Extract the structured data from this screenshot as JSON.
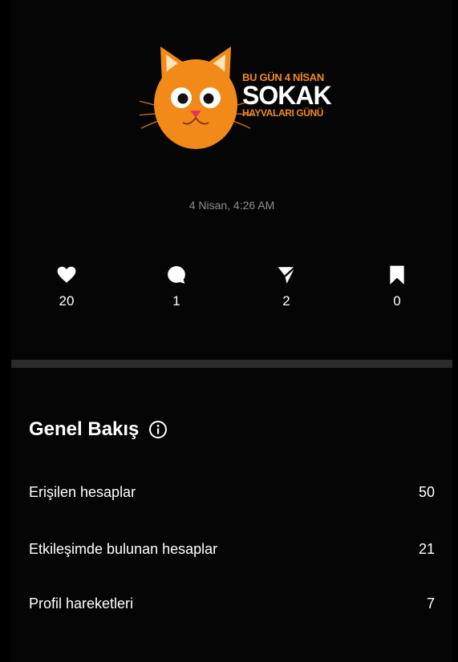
{
  "post": {
    "line1": "BU GÜN 4 NİSAN",
    "line2": "SOKAK",
    "line3": "HAYVALARI GÜNÜ",
    "image_icon": "orange-cat-face",
    "accent_color": "#f28a1a"
  },
  "timestamp": "4 Nisan, 4:26 AM",
  "stats": [
    {
      "icon": "heart-icon",
      "count": "20"
    },
    {
      "icon": "comment-icon",
      "count": "1"
    },
    {
      "icon": "share-icon",
      "count": "2"
    },
    {
      "icon": "bookmark-icon",
      "count": "0"
    }
  ],
  "overview": {
    "title": "Genel Bakış",
    "info_icon": "info-icon",
    "rows": [
      {
        "label": "Erişilen hesaplar",
        "value": "50"
      },
      {
        "label": "Etkileşimde bulunan hesaplar",
        "value": "21"
      },
      {
        "label": "Profil hareketleri",
        "value": "7"
      }
    ]
  }
}
